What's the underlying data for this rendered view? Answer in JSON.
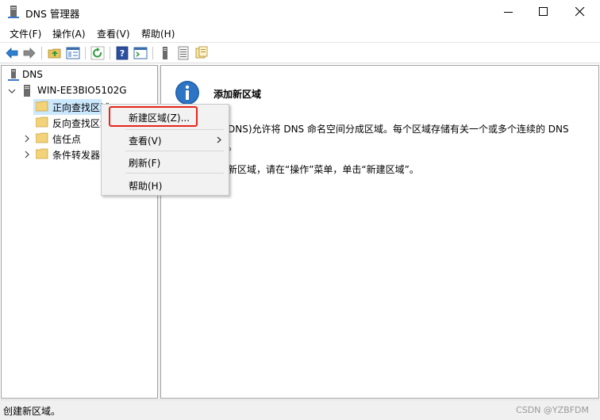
{
  "window": {
    "title": "DNS 管理器",
    "controls": {
      "minimize": "minimize-icon",
      "maximize": "maximize-icon",
      "close": "close-icon"
    }
  },
  "menu": {
    "file": "文件(F)",
    "action": "操作(A)",
    "view": "查看(V)",
    "help": "帮助(H)"
  },
  "toolbar": {
    "icons": [
      "back-arrow-icon",
      "forward-arrow-icon",
      "up-folder-icon",
      "show-hide-tree-icon",
      "refresh-icon",
      "help-book-icon",
      "console-icon",
      "server-icon",
      "list-icon",
      "new-zone-icon"
    ]
  },
  "tree": {
    "root": "DNS",
    "server": "WIN-EE3BIO5102G",
    "items": [
      {
        "label": "正向查找区域",
        "selected": true
      },
      {
        "label": "反向查找区域",
        "selected": false
      },
      {
        "label": "信任点",
        "selected": false
      },
      {
        "label": "条件转发器",
        "selected": false
      }
    ]
  },
  "details": {
    "title": "添加新区域",
    "line1": "DNS)允许将 DNS 命名空间分成区域。每个区域存储有关一个或多个连续的 DNS",
    "line2": "。",
    "line3": "新区域，请在“操作”菜单，单击“新建区域”。"
  },
  "context_menu": {
    "items": [
      {
        "label": "新建区域(Z)...",
        "highlighted": true
      },
      {
        "label": "查看(V)",
        "has_submenu": true
      },
      {
        "label": "刷新(F)"
      },
      {
        "label": "帮助(H)"
      }
    ]
  },
  "status": {
    "text": "创建新区域。",
    "watermark": "CSDN @YZBFDM"
  },
  "colors": {
    "selection": "#cce8ff",
    "highlight_border": "#e5261a",
    "info_blue": "#1f5fa8"
  }
}
